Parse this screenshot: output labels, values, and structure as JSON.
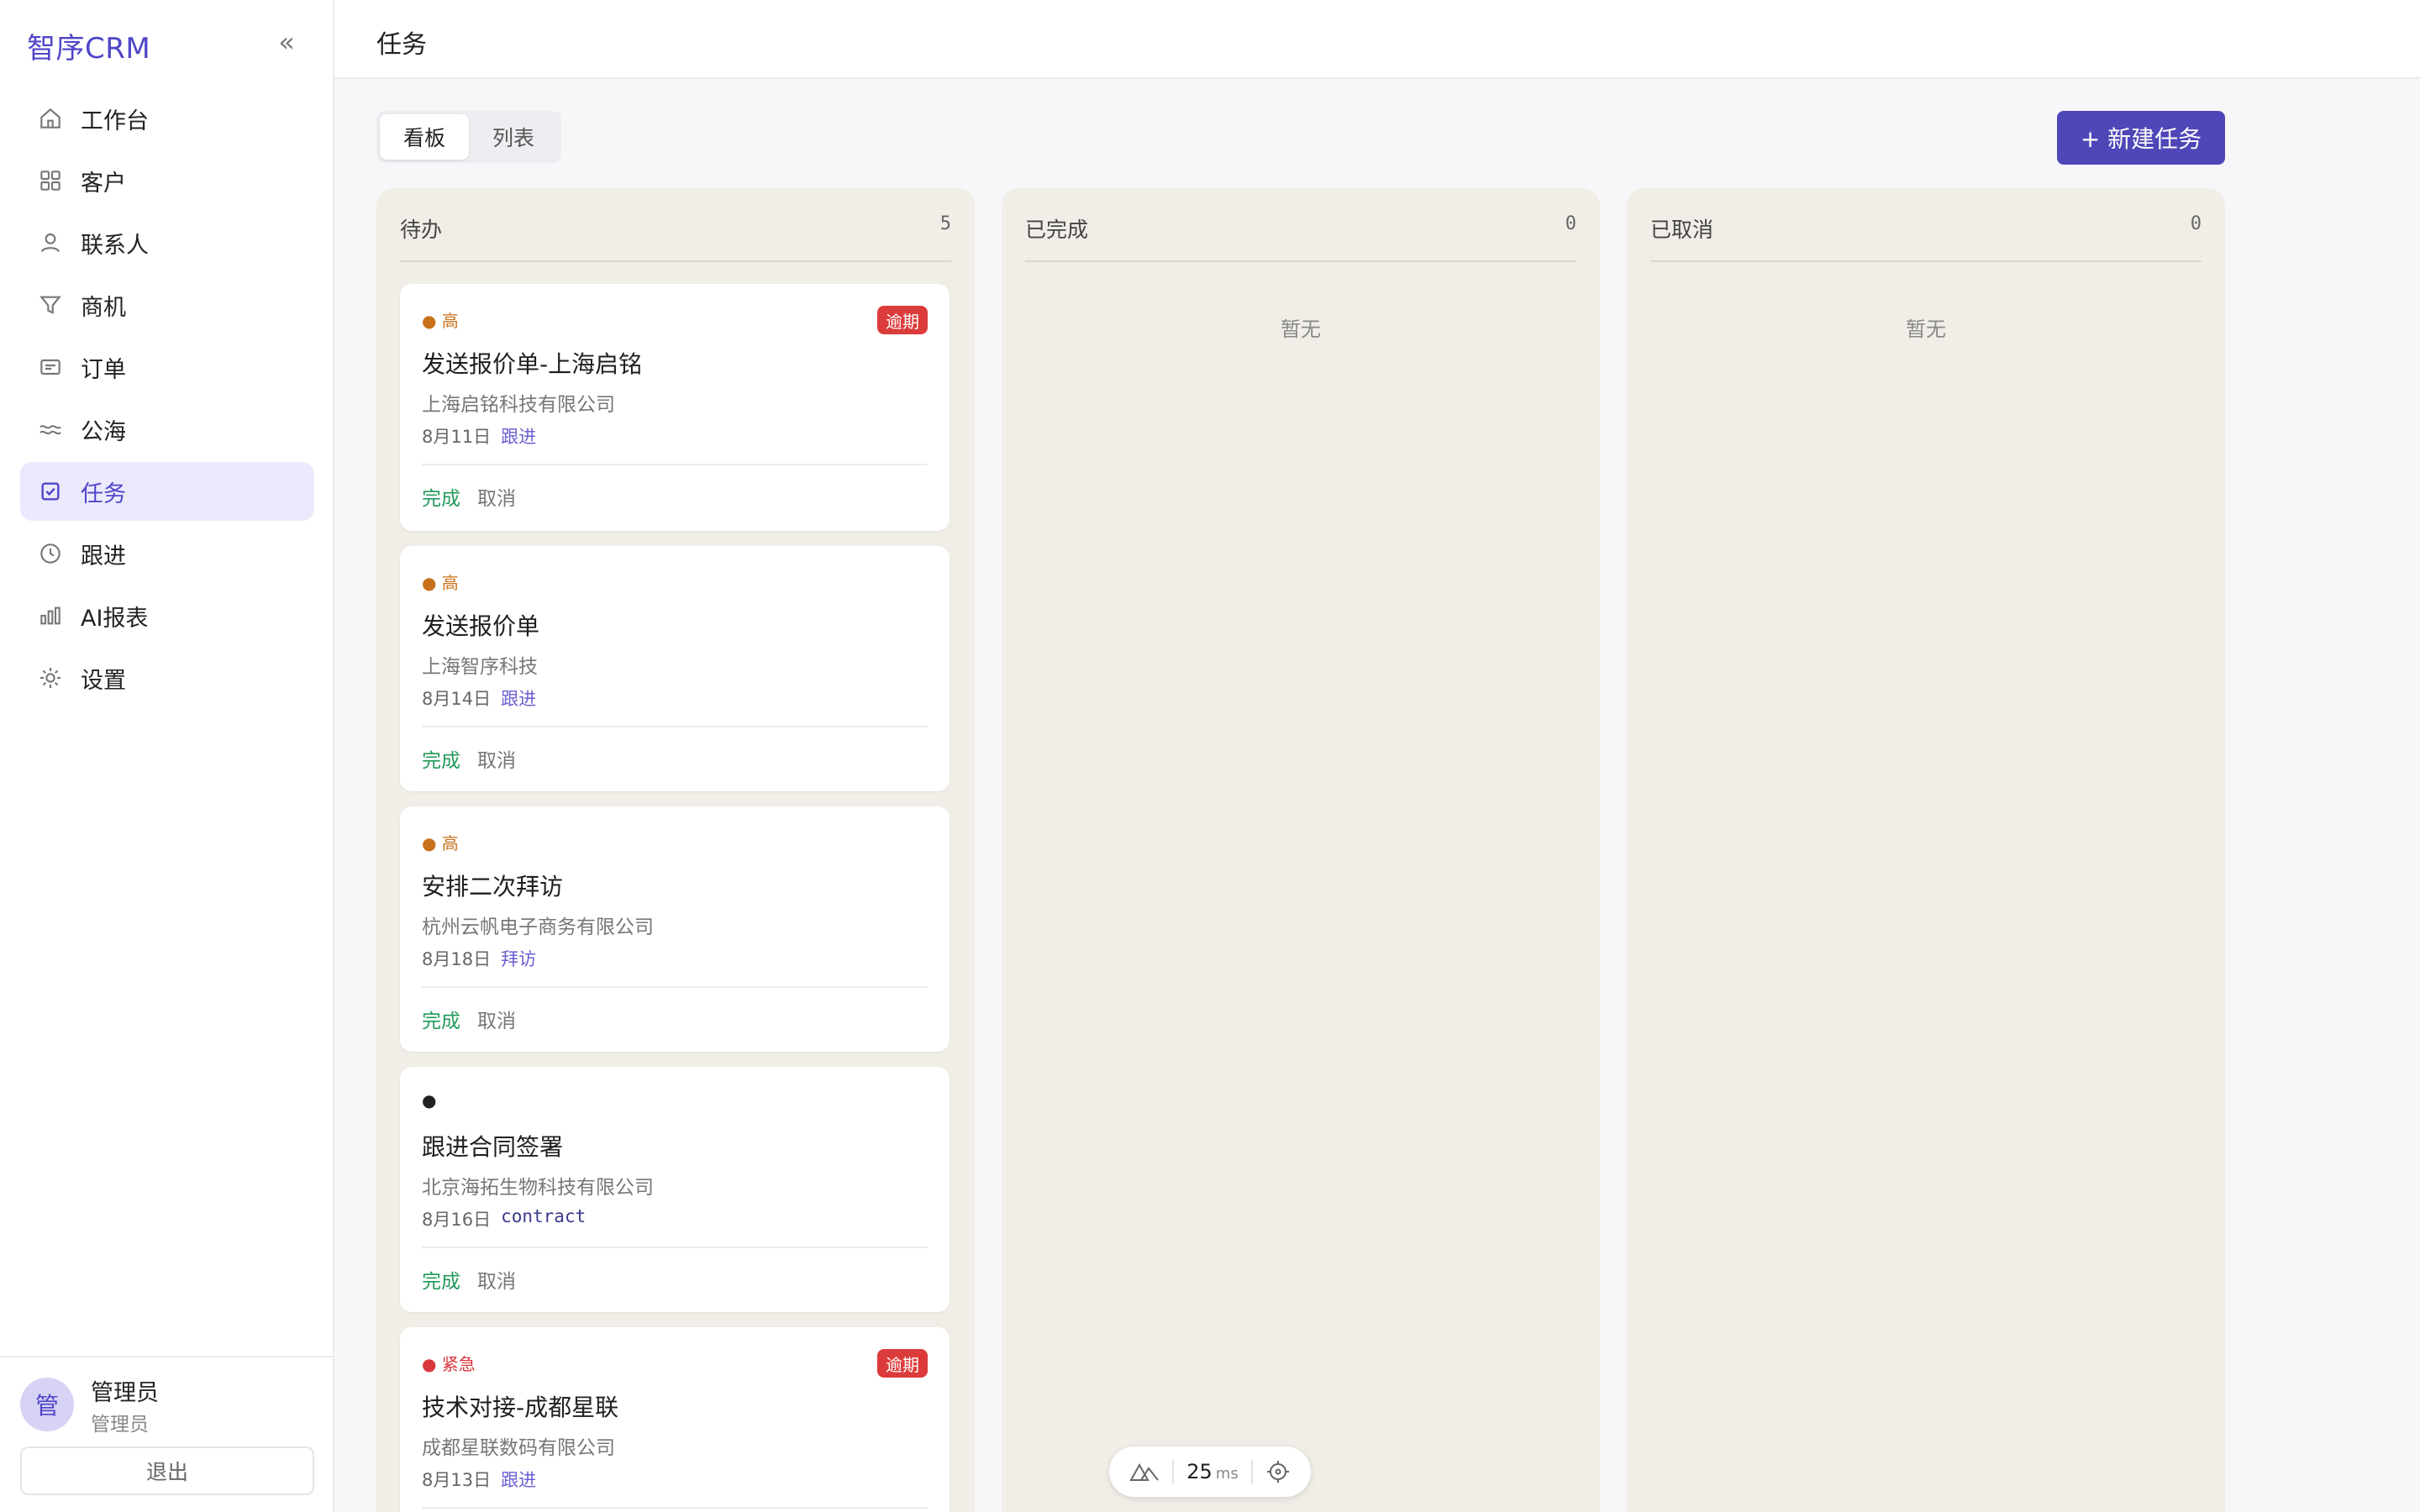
{
  "app": {
    "brand": "智序CRM",
    "collapse_glyph": "«"
  },
  "sidebar": {
    "items": [
      {
        "label": "工作台",
        "icon": "home-icon"
      },
      {
        "label": "客户",
        "icon": "grid-icon"
      },
      {
        "label": "联系人",
        "icon": "user-icon"
      },
      {
        "label": "商机",
        "icon": "funnel-icon"
      },
      {
        "label": "订单",
        "icon": "order-icon"
      },
      {
        "label": "公海",
        "icon": "waves-icon"
      },
      {
        "label": "任务",
        "icon": "task-icon",
        "active": true
      },
      {
        "label": "跟进",
        "icon": "clock-icon"
      },
      {
        "label": "AI报表",
        "icon": "bar-chart-icon"
      },
      {
        "label": "设置",
        "icon": "sun-gear-icon"
      }
    ],
    "user": {
      "avatar": "管",
      "name": "管理员",
      "role": "管理员",
      "logout": "退出"
    }
  },
  "header": {
    "title": "任务"
  },
  "toolbar": {
    "view_tabs": [
      {
        "label": "看板",
        "active": true
      },
      {
        "label": "列表",
        "active": false
      }
    ],
    "new_task": "+ 新建任务"
  },
  "board": {
    "columns": [
      {
        "title": "待办",
        "count": "5",
        "cards": [
          {
            "priority": "● 高",
            "priority_level": "high",
            "overdue": "逾期",
            "title": "发送报价单-上海启铭",
            "company": "上海启铭科技有限公司",
            "date": "8月11日",
            "type": "跟进",
            "done": "完成",
            "cancel": "取消"
          },
          {
            "priority": "● 高",
            "priority_level": "high",
            "overdue": "",
            "title": "发送报价单",
            "company": "上海智序科技",
            "date": "8月14日",
            "type": "跟进",
            "done": "完成",
            "cancel": "取消"
          },
          {
            "priority": "● 高",
            "priority_level": "high",
            "overdue": "",
            "title": "安排二次拜访",
            "company": "杭州云帆电子商务有限公司",
            "date": "8月18日",
            "type": "拜访",
            "done": "完成",
            "cancel": "取消"
          },
          {
            "priority": "●",
            "priority_level": "none",
            "overdue": "",
            "title": "跟进合同签署",
            "company": "北京海拓生物科技有限公司",
            "date": "8月16日",
            "type": "contract",
            "done": "完成",
            "cancel": "取消"
          },
          {
            "priority": "● 紧急",
            "priority_level": "urgent",
            "overdue": "逾期",
            "title": "技术对接-成都星联",
            "company": "成都星联数码有限公司",
            "date": "8月13日",
            "type": "跟进",
            "done": "完成",
            "cancel": "取消"
          }
        ]
      },
      {
        "title": "已完成",
        "count": "0",
        "empty": "暂无"
      },
      {
        "title": "已取消",
        "count": "0",
        "empty": "暂无"
      }
    ]
  },
  "perf": {
    "value": "25",
    "unit": "ms"
  },
  "colors": {
    "accent": "#4f46c8",
    "button": "#4f46b8",
    "overdue": "#dc3b3b",
    "done": "#239a5b",
    "high": "#c7711a",
    "urgent": "#d9363e",
    "column_bg": "#f1eee8"
  }
}
